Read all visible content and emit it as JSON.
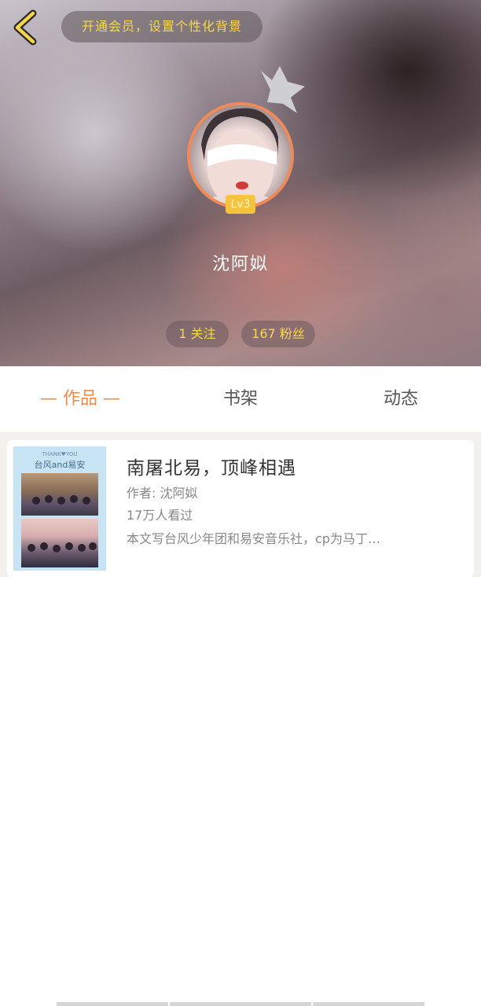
{
  "header": {
    "vip_banner": "开通会员，设置个性化背景",
    "level": "Lv3",
    "username": "沈阿姒",
    "stats": {
      "following": "1 关注",
      "fans": "167 粉丝"
    },
    "icons": {
      "back": "chevron-left-icon",
      "crown": "crown-icon"
    },
    "colors": {
      "accent_yellow": "#f7d84a",
      "avatar_ring": "#ef8a5a",
      "level_badge": "#f6c33c"
    }
  },
  "tabs": {
    "works": "— 作品 —",
    "shelf": "书架",
    "moments": "动态",
    "active_color": "#ef8b48"
  },
  "works": [
    {
      "cover_small": "THANK♥YOU",
      "cover_title": "台风and易安",
      "title": "南屠北易，顶峰相遇",
      "author": "作者: 沈阿姒",
      "views": "17万人看过",
      "description": "本文写台风少年团和易安音乐社，cp为马丁…"
    }
  ]
}
